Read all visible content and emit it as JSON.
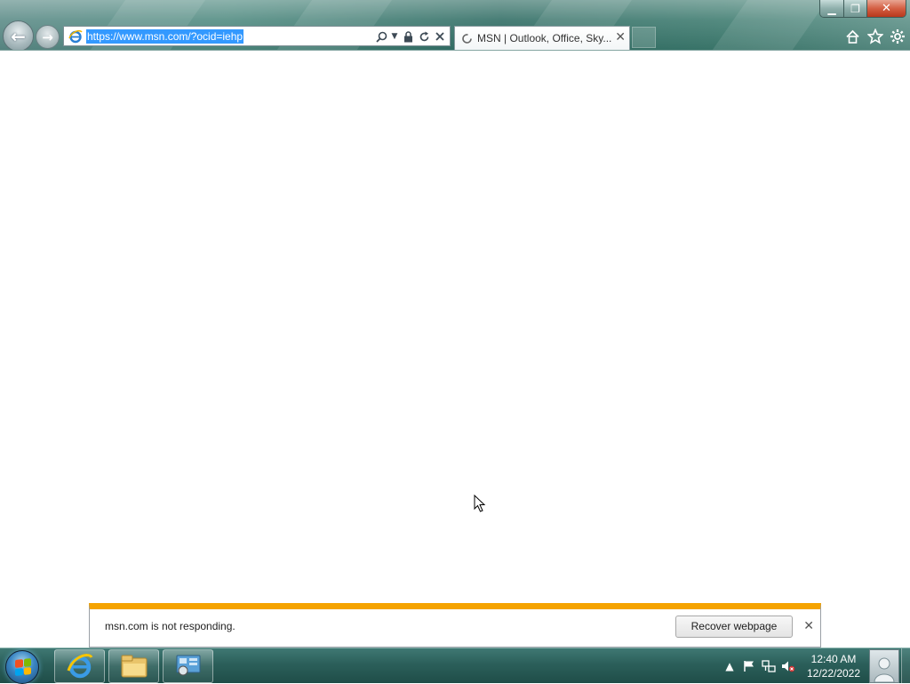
{
  "browser": {
    "address": {
      "url": "https://www.msn.com/?ocid=iehp"
    },
    "tabs": [
      {
        "title": "MSN | Outlook, Office, Sky..."
      }
    ],
    "caption": {
      "minimize": "▁",
      "maximize": "❐",
      "close": "✕"
    },
    "toolbar_icons": [
      "home-icon",
      "star-icon",
      "gear-icon"
    ]
  },
  "notification": {
    "message": "msn.com is not responding.",
    "button_label": "Recover webpage",
    "close_glyph": "✕",
    "accent_color": "#f5a300"
  },
  "taskbar": {
    "pinned": [
      "internet-explorer-icon",
      "file-explorer-icon",
      "control-panel-icon"
    ],
    "tray_icons": [
      "show-hidden-icons-chevron",
      "action-center-flag-icon",
      "network-icon",
      "volume-muted-icon"
    ],
    "clock": {
      "time": "12:40 AM",
      "date": "12/22/2022"
    }
  }
}
